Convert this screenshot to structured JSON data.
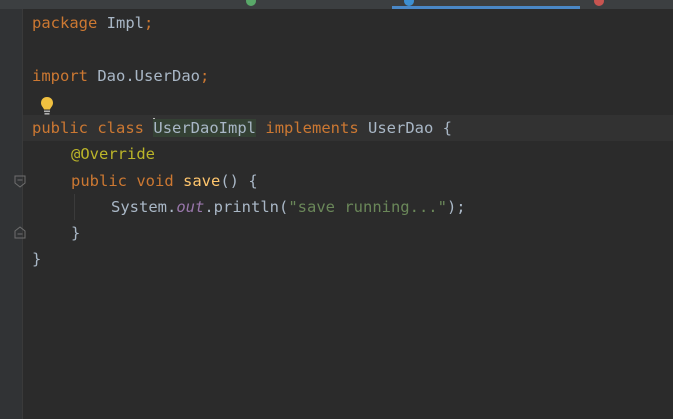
{
  "code": {
    "line1": {
      "kw": "package",
      "name": " Impl",
      "semi": ";"
    },
    "line3": {
      "kw": "import",
      "name": " Dao.UserDao",
      "semi": ";"
    },
    "line5": {
      "kw1": "public",
      "kw2": "class",
      "class_name": "UserDaoImpl",
      "kw3": "implements",
      "iface": " UserDao {"
    },
    "line6": {
      "anno": "@Override"
    },
    "line7": {
      "kw1": "public",
      "kw2": "void",
      "fn": "save",
      "rest": "() {"
    },
    "line8": {
      "obj": "System.",
      "field": "out",
      "call": ".println(",
      "str": "\"save running...\"",
      "end": ");"
    },
    "line9": {
      "brace": "}"
    },
    "line10": {
      "brace": "}"
    }
  },
  "colors": {
    "background": "#2b2b2b",
    "keyword": "#cc7832",
    "annotation": "#bbb529",
    "method": "#ffc66d",
    "string": "#6a8759",
    "field": "#9876aa",
    "active_tab": "#4a88c7"
  },
  "icons": {
    "intention": "lightbulb-icon",
    "fold": "fold-marker-icon"
  }
}
